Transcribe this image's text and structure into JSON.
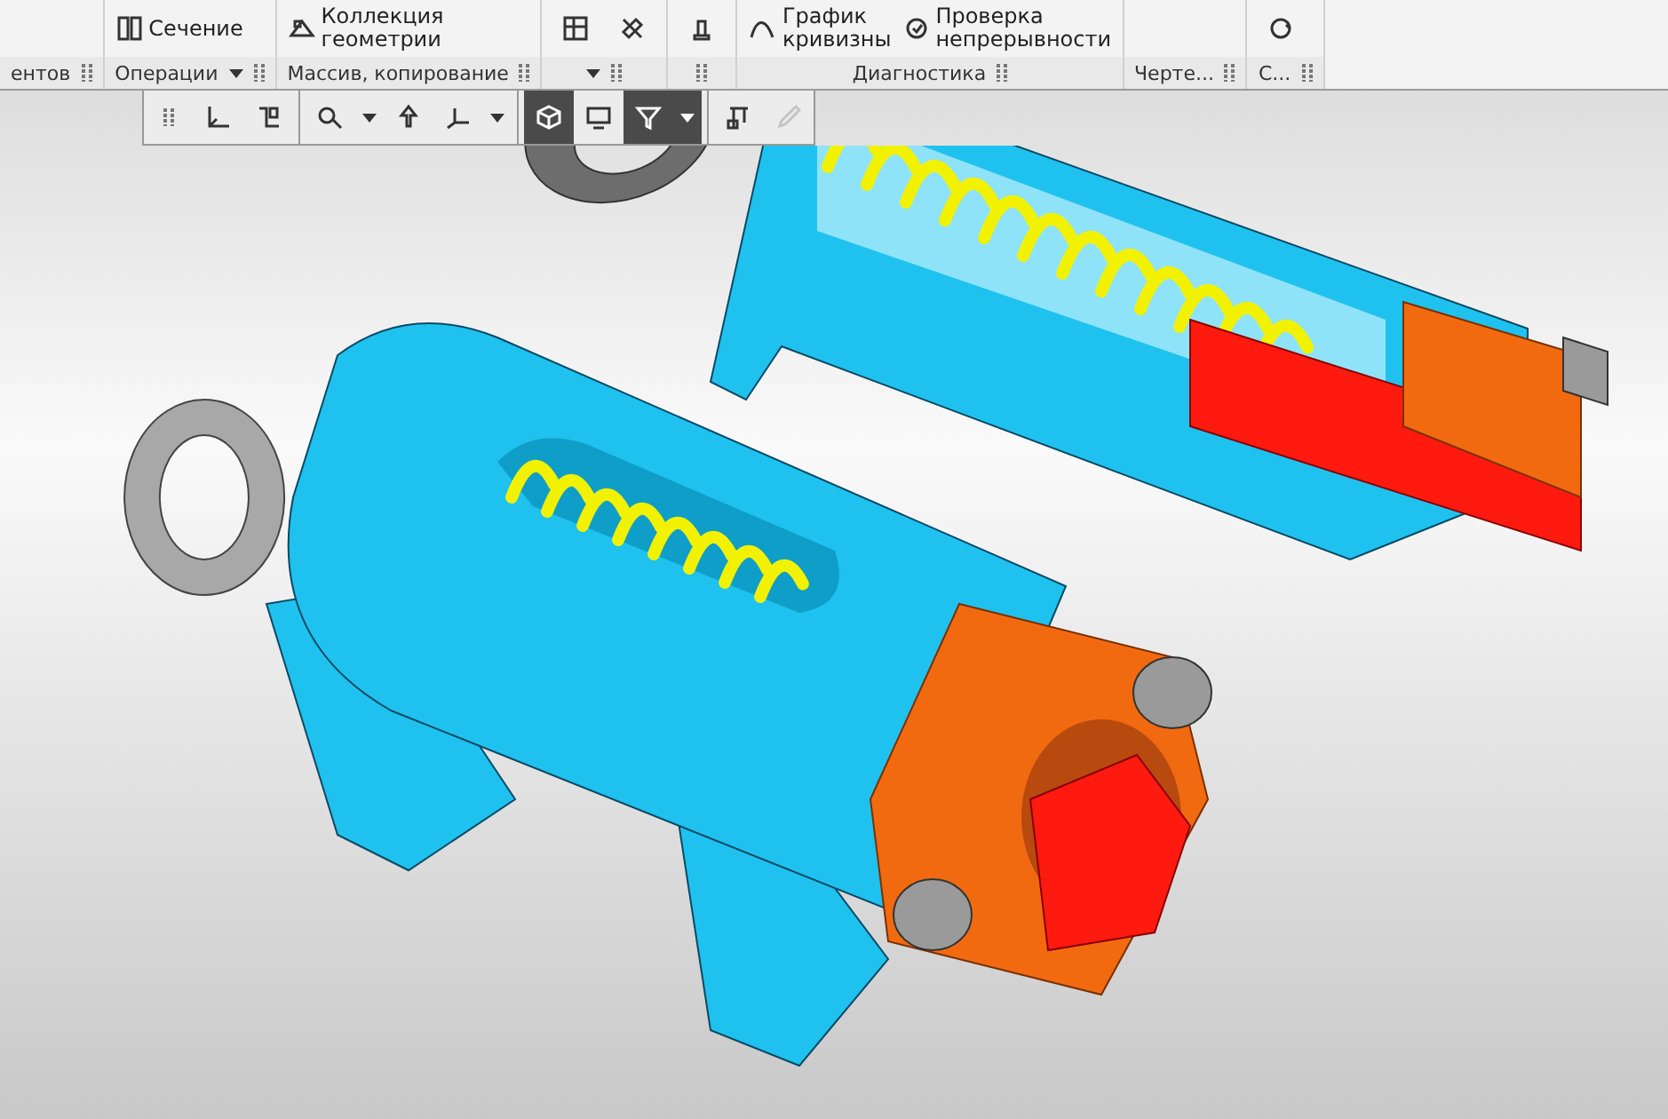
{
  "ribbon": {
    "groups": [
      {
        "label": "ентов"
      },
      {
        "label": "Операции",
        "buttons": [
          {
            "kind": "labeled",
            "lines": [
              "Сечение"
            ]
          }
        ],
        "menu": true
      },
      {
        "label": "Массив, копирование",
        "buttons": [
          {
            "kind": "labeled",
            "lines": [
              "Коллекция",
              "геометрии"
            ]
          }
        ]
      },
      {
        "buttons": [
          {
            "kind": "icon"
          },
          {
            "kind": "icon"
          }
        ],
        "menu": true
      },
      {
        "buttons": [
          {
            "kind": "icon"
          }
        ]
      },
      {
        "label": "Диагностика",
        "buttons": [
          {
            "kind": "labeled",
            "lines": [
              "График",
              "кривизны"
            ]
          },
          {
            "kind": "labeled",
            "lines": [
              "Проверка",
              "непрерывности"
            ]
          }
        ]
      },
      {
        "label": "Черте..."
      },
      {
        "label": "С...",
        "buttons": [
          {
            "kind": "icon"
          }
        ]
      }
    ]
  },
  "view_toolbar": {
    "items": [
      {
        "kind": "grip"
      },
      {
        "kind": "button",
        "selected": false,
        "disabled": false
      },
      {
        "kind": "button",
        "selected": false,
        "disabled": false
      },
      {
        "kind": "separator"
      },
      {
        "kind": "button",
        "selected": false,
        "disabled": false
      },
      {
        "kind": "dropdown",
        "selected": false
      },
      {
        "kind": "button",
        "selected": false,
        "disabled": false
      },
      {
        "kind": "button",
        "selected": false,
        "disabled": false
      },
      {
        "kind": "dropdown",
        "selected": false
      },
      {
        "kind": "separator"
      },
      {
        "kind": "button",
        "selected": true,
        "disabled": false
      },
      {
        "kind": "button",
        "selected": false,
        "disabled": false
      },
      {
        "kind": "button",
        "selected": true,
        "disabled": false
      },
      {
        "kind": "dropdown",
        "selected": true
      },
      {
        "kind": "separator"
      },
      {
        "kind": "button",
        "selected": false,
        "disabled": false
      },
      {
        "kind": "button",
        "selected": false,
        "disabled": true
      }
    ]
  }
}
